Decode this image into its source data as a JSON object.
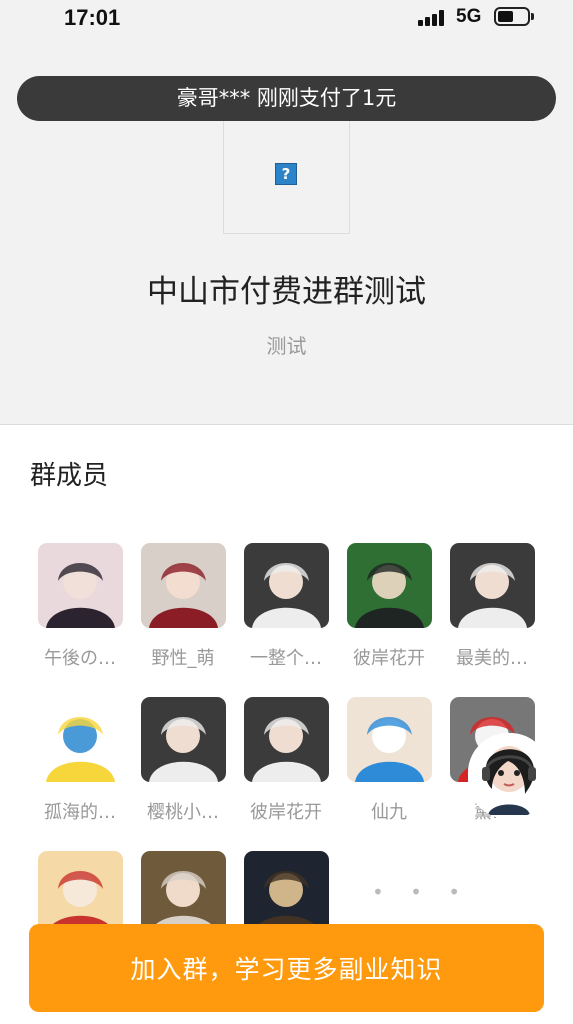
{
  "status_bar": {
    "time": "17:01",
    "network": "5G",
    "signal_icon": "signal-bars-icon",
    "battery_icon": "battery-icon",
    "battery_level": 0.45
  },
  "toast": {
    "text": "豪哥*** 刚刚支付了1元"
  },
  "group": {
    "image_icon": "broken-image-icon",
    "title": "中山市付费进群测试",
    "description": "测试"
  },
  "members": {
    "title": "群成员",
    "items": [
      {
        "name": "午後の…",
        "avatar_colors": [
          "#e9d8dc",
          "#2b2430",
          "#f1e0da"
        ]
      },
      {
        "name": "野性_萌",
        "avatar_colors": [
          "#d8cfc8",
          "#8b1d26",
          "#f2ddd0"
        ]
      },
      {
        "name": "一整个…",
        "avatar_colors": [
          "#3b3b3b",
          "#ededed",
          "#f0ddd1"
        ]
      },
      {
        "name": "彼岸花开",
        "avatar_colors": [
          "#2f6f34",
          "#1f2522",
          "#ddd2b9"
        ]
      },
      {
        "name": "最美的…",
        "avatar_colors": [
          "#3b3b3b",
          "#ededed",
          "#f0ddd1"
        ]
      },
      {
        "name": "孤海的…",
        "avatar_colors": [
          "#ffffff",
          "#f7d63b",
          "#4a9ad8"
        ]
      },
      {
        "name": "樱桃小…",
        "avatar_colors": [
          "#3b3b3b",
          "#ededed",
          "#f0ddd1"
        ]
      },
      {
        "name": "彼岸花开",
        "avatar_colors": [
          "#3b3b3b",
          "#ededed",
          "#f0ddd1"
        ]
      },
      {
        "name": "仙九",
        "avatar_colors": [
          "#efe3d6",
          "#2d8bd8",
          "#ffffff"
        ]
      },
      {
        "name": "薰…",
        "avatar_colors": [
          "#777777",
          "#d72323",
          "#f4f4f4"
        ]
      },
      {
        "name": "",
        "avatar_colors": [
          "#f5d9a7",
          "#c8342d",
          "#f6e9da"
        ]
      },
      {
        "name": "",
        "avatar_colors": [
          "#6f5a3c",
          "#d8d0c7",
          "#f0dac9"
        ]
      },
      {
        "name": "",
        "avatar_colors": [
          "#1e2530",
          "#413224",
          "#d0b58a"
        ]
      }
    ],
    "more_text": "• • •"
  },
  "customer_service": {
    "icon": "customer-service-avatar-icon"
  },
  "join_button": {
    "label": "加入群，学习更多副业知识",
    "color": "#ff9a0e"
  }
}
